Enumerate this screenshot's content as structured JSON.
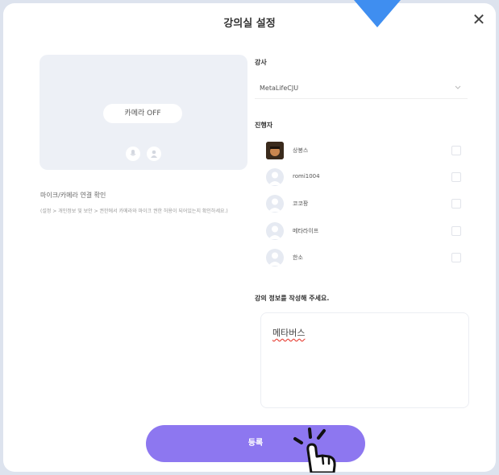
{
  "dialog": {
    "title": "강의실 설정",
    "close_icon": "close-icon"
  },
  "preview": {
    "camera_badge": "카메라 OFF",
    "icons": [
      "microphone-icon",
      "person-icon"
    ]
  },
  "mic_check": {
    "title": "마이크/카메라 연결 확인",
    "description": "(설정 > 개인정보 및 보안 > 권한에서 카메라와 마이크 권한 허용이 되어있는지 확인하세요.)"
  },
  "instructor": {
    "label": "강사",
    "selected": "MetaLifeCJU",
    "dropdown_icon": "chevron-down-icon"
  },
  "hosts": {
    "label": "진행자",
    "people": [
      {
        "name": "상봉스",
        "avatar": "photo"
      },
      {
        "name": "romi1004",
        "avatar": "default"
      },
      {
        "name": "코코팡",
        "avatar": "default"
      },
      {
        "name": "메타라이프",
        "avatar": "default"
      },
      {
        "name": "한소",
        "avatar": "default"
      }
    ]
  },
  "info": {
    "label": "강의 정보를 작성해 주세요.",
    "value": "메타버스"
  },
  "submit": {
    "label": "등록"
  },
  "colors": {
    "accent": "#8d77f0",
    "pointer_arrow": "#3f8ef0"
  }
}
